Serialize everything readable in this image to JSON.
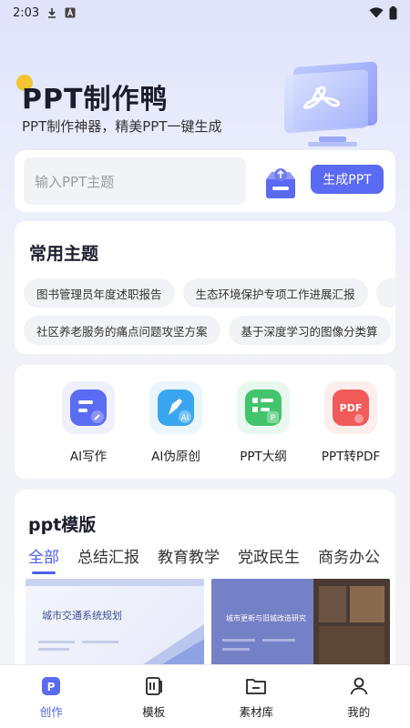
{
  "status_bar": {
    "time": "2:03"
  },
  "header": {
    "title": "PPT制作鸭",
    "subtitle": "PPT制作神器，精美PPT一键生成"
  },
  "search": {
    "placeholder": "输入PPT主题",
    "generate_label": "生成PPT"
  },
  "topics": {
    "title": "常用主题",
    "row1": [
      "图书管理员年度述职报告",
      "生态环境保护专项工作进展汇报",
      "…"
    ],
    "row2": [
      "社区养老服务的痛点问题攻坚方案",
      "基于深度学习的图像分类算"
    ]
  },
  "tools": [
    {
      "label": "AI写作",
      "icon": "ai-writing-icon",
      "color": "#5b6cf3"
    },
    {
      "label": "AI伪原创",
      "icon": "ai-rewrite-icon",
      "color": "#3aa6f2"
    },
    {
      "label": "PPT大纲",
      "icon": "ppt-outline-icon",
      "color": "#43c46c"
    },
    {
      "label": "PPT转PDF",
      "icon": "ppt-to-pdf-icon",
      "color": "#f35a5a"
    }
  ],
  "templates": {
    "title": "ppt模版",
    "tabs": [
      "全部",
      "总结汇报",
      "教育教学",
      "党政民生",
      "商务办公"
    ],
    "active_tab": "全部",
    "items": [
      {
        "title": "城市交通系统规划"
      },
      {
        "title": "城市更新与旧城改造研究"
      }
    ]
  },
  "bottom_nav": {
    "items": [
      "创作",
      "模板",
      "素材库",
      "我的"
    ],
    "active": "创作"
  },
  "colors": {
    "accent": "#5a6af3",
    "background": "#f3f4f8"
  }
}
